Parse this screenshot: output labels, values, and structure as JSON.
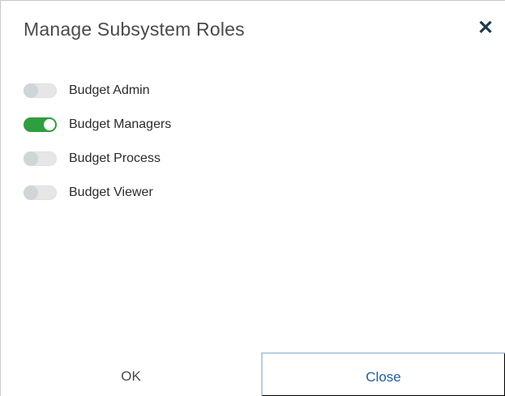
{
  "dialog": {
    "title": "Manage Subsystem Roles",
    "close_icon": "close-icon"
  },
  "roles": [
    {
      "label": "Budget Admin",
      "enabled": false
    },
    {
      "label": "Budget Managers",
      "enabled": true
    },
    {
      "label": "Budget Process",
      "enabled": false
    },
    {
      "label": "Budget Viewer",
      "enabled": false
    }
  ],
  "footer": {
    "ok_label": "OK",
    "close_label": "Close"
  },
  "colors": {
    "toggle_on": "#2e9e3f",
    "toggle_off": "#e6e6e6",
    "close_text": "#1d5fa6",
    "close_border": "#b7cfe3"
  }
}
